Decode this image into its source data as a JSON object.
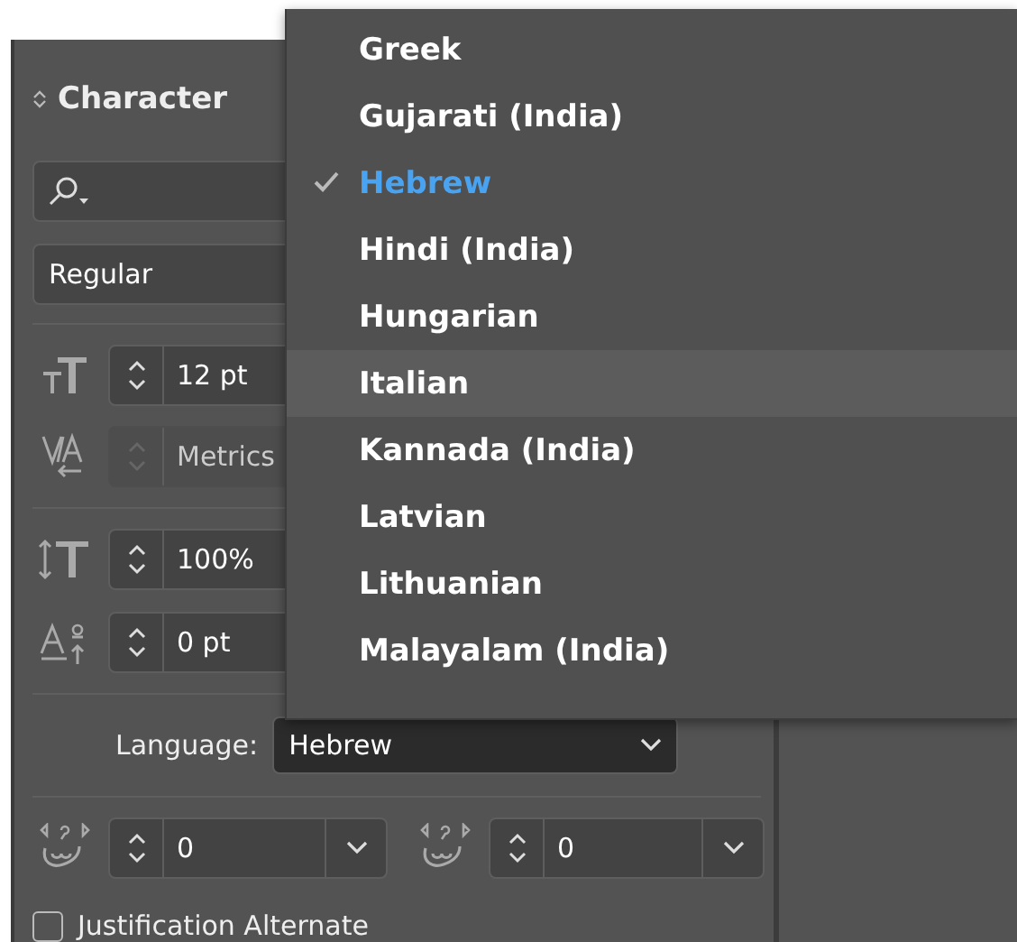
{
  "panel": {
    "title": "Character",
    "font_style": "Regular",
    "font_size": {
      "value": "12 pt",
      "disabled": false
    },
    "tracking": {
      "value": "Metrics",
      "disabled": true
    },
    "leading": {
      "value": "100%",
      "disabled": false
    },
    "baseline_shift": {
      "value": "0 pt",
      "disabled": false
    },
    "language": {
      "label": "Language:",
      "value": "Hebrew"
    },
    "kashida": {
      "value": "0",
      "disabled": false
    },
    "diacritic": {
      "value": "0",
      "disabled": false
    },
    "justification_alternate": {
      "label": "Justification Alternate",
      "checked": false
    }
  },
  "language_menu": {
    "items": [
      {
        "label": "Greek",
        "selected": false,
        "hovered": false
      },
      {
        "label": "Gujarati (India)",
        "selected": false,
        "hovered": false
      },
      {
        "label": "Hebrew",
        "selected": true,
        "hovered": false
      },
      {
        "label": "Hindi (India)",
        "selected": false,
        "hovered": false
      },
      {
        "label": "Hungarian",
        "selected": false,
        "hovered": false
      },
      {
        "label": "Italian",
        "selected": false,
        "hovered": true
      },
      {
        "label": "Kannada (India)",
        "selected": false,
        "hovered": false
      },
      {
        "label": "Latvian",
        "selected": false,
        "hovered": false
      },
      {
        "label": "Lithuanian",
        "selected": false,
        "hovered": false
      },
      {
        "label": "Malayalam (India)",
        "selected": false,
        "hovered": false
      }
    ]
  }
}
